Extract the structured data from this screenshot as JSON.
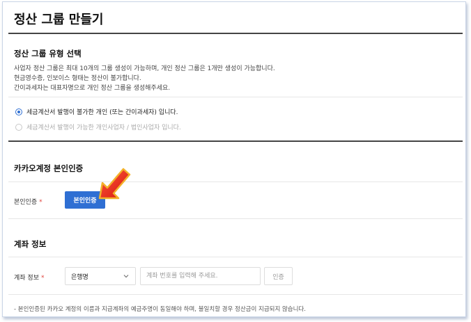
{
  "page": {
    "title": "정산 그룹 만들기"
  },
  "group_type": {
    "title": "정산 그룹 유형 선택",
    "descriptions": [
      "사업자 정산 그룹은 최대 10개의 그룹 생성이 가능하며, 개인 정산 그룹은 1개만 생성이 가능합니다.",
      "현금영수증, 인보이스 형태는 정산이 불가합니다.",
      "간이과세자는 대표자명으로 개인 정산 그룹을 생성해주세요."
    ],
    "options": [
      {
        "label": "세금계산서 발행이 불가한 개인 (또는 간이과세자) 입니다.",
        "selected": true
      },
      {
        "label": "세금계산서 발행이 가능한 개인사업자 / 법인사업자 입니다.",
        "selected": false
      }
    ]
  },
  "identity": {
    "title": "카카오계정 본인인증",
    "label": "본인인증",
    "required_mark": "*",
    "button_label": "본인인증"
  },
  "account": {
    "title": "계좌 정보",
    "label": "계좌 정보",
    "required_mark": "*",
    "bank_select_value": "은행명",
    "account_placeholder": "계좌 번호를 입력해 주세요.",
    "verify_button_label": "인증",
    "notice": "- 본인인증된 카카오 계정의 이름과 지급계좌의 예금주명이 동일해야 하며, 불일치할 경우 정산금이 지급되지 않습니다."
  },
  "colors": {
    "primary": "#2f6fd3",
    "required": "#e0433c",
    "arrow": "#e8251f"
  }
}
